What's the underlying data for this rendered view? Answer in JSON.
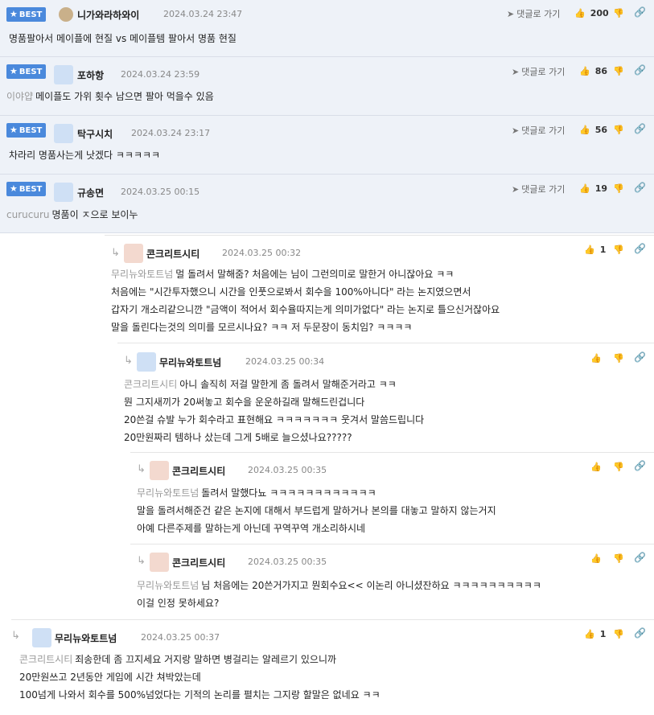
{
  "best_label": "BEST",
  "reply_go_label": "댓글로 가기",
  "best_comments": [
    {
      "nick": "니가와라하와이",
      "date": "2024.03.24 23:47",
      "likes": "200",
      "mention": "",
      "text": "명품팔아서 메이플에 현질 vs 메이플템 팔아서 명품 현질"
    },
    {
      "nick": "포하항",
      "date": "2024.03.24 23:59",
      "likes": "86",
      "mention": "이야얍",
      "text": "메이플도 가위 횟수 남으면 팔아 먹을수 있음"
    },
    {
      "nick": "탁구시치",
      "date": "2024.03.24 23:17",
      "likes": "56",
      "mention": "",
      "text": "차라리 명품사는게 낫겠다 ㅋㅋㅋㅋㅋ"
    },
    {
      "nick": "규송면",
      "date": "2024.03.25 00:15",
      "likes": "19",
      "mention": "curucuru",
      "text": "명품이 ㅈ으로 보이누"
    }
  ],
  "replies": [
    {
      "nick": "콘크리트시티",
      "date": "2024.03.25 00:32",
      "likes": "1",
      "mention": "무리뉴와토트넘",
      "lines": [
        "멀 돌려서 말해줌? 처음에는 님이 그런의미로 말한거 아니잖아요 ㅋㅋ",
        "처음에는 \"시간투자했으니 시간을 인풋으로봐서 회수을 100%아니다\" 라는 논지였으면서",
        "갑자기 개소리같으니깐 \"금액이 적어서 회수율따지는게 의미가없다\" 라는 논지로 틀으신거잖아요",
        "말을 돌린다는것의 의미를 모르시나요? ㅋㅋ 저 두문장이 동치임? ㅋㅋㅋㅋ"
      ]
    },
    {
      "nick": "무리뉴와토트넘",
      "date": "2024.03.25 00:34",
      "likes": "",
      "mention": "콘크리트시티",
      "lines": [
        "아니 솔직히 저걸 말한게 좀 돌려서 말해준거라고 ㅋㅋ",
        "뭔 그지새끼가 20써놓고 회수을 운운하길래 말해드린겁니다",
        "20쓴걸 슈발 누가 회수라고 표현해요 ㅋㅋㅋㅋㅋㅋㅋ 웃겨서 말씀드립니다",
        "20만원짜리 템하나 샀는데 그게 5배로 늘으셨나요?????"
      ]
    },
    {
      "nick": "콘크리트시티",
      "date": "2024.03.25 00:35",
      "likes": "",
      "mention": "무리뉴와토트넘",
      "lines": [
        "돌려서 말했다뇨 ㅋㅋㅋㅋㅋㅋㅋㅋㅋㅋㅋㅋ",
        "말을 돌려서해준건 같은 논지에 대해서 부드럽게 말하거나 본의를 대놓고 말하지 않는거지",
        "아예 다른주제를 말하는게 아닌데 꾸역꾸역 개소리하시네"
      ]
    },
    {
      "nick": "콘크리트시티",
      "date": "2024.03.25 00:35",
      "likes": "",
      "mention": "무리뉴와토트넘",
      "lines": [
        "님 처음에는 20쓴거가지고 뭔회수요<< 이논리 아니셨잔하요 ㅋㅋㅋㅋㅋㅋㅋㅋㅋㅋ",
        "이걸 인정 못하세요?"
      ]
    },
    {
      "nick": "무리뉴와토트넘",
      "date": "2024.03.25 00:37",
      "likes": "1",
      "mention": "콘크리트시티",
      "lines": [
        "죄송한데 좀 끄지세요 거지랑 말하면 병걸리는 알레르기 있으니까",
        "20만원쓰고 2년동안 게임에 시간 쳐박았는데",
        "100넘게 나와서 회수를 500%넘었다는 기적의 논리를 펼치는 그지랑 할말은 없네요 ㅋㅋ"
      ]
    }
  ],
  "colors": {
    "accent": "#4a89dc",
    "best_bg": "#eef2f8",
    "mention": "#999999"
  }
}
